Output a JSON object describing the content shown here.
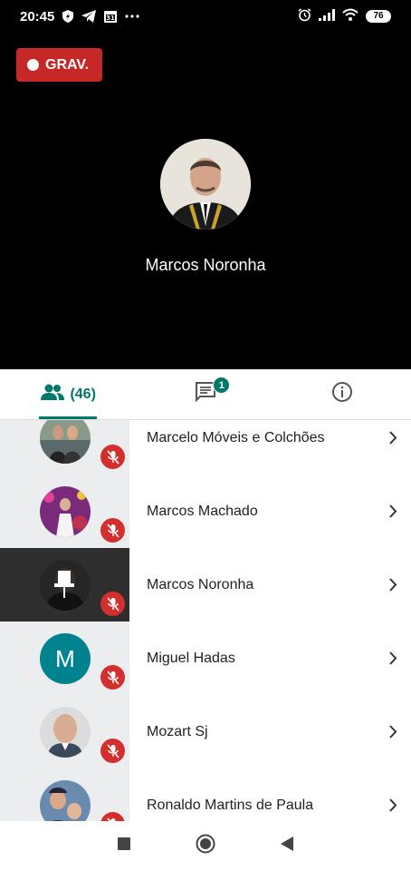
{
  "status_bar": {
    "time": "20:45",
    "battery": "76"
  },
  "video": {
    "record_label": "GRAV.",
    "speaker_name": "Marcos Noronha"
  },
  "tabs": {
    "people_count": "(46)",
    "chat_badge": "1"
  },
  "participants": [
    {
      "name": "Marcelo Móveis e Colchões",
      "avatar_type": "photo",
      "muted": true
    },
    {
      "name": "Marcos Machado",
      "avatar_type": "photo",
      "muted": true
    },
    {
      "name": "Marcos Noronha",
      "avatar_type": "pinned",
      "muted": true,
      "highlighted": true
    },
    {
      "name": "Miguel Hadas",
      "avatar_type": "letter",
      "initial": "M",
      "avatar_color": "#00838f",
      "muted": true
    },
    {
      "name": "Mozart Sj",
      "avatar_type": "photo",
      "muted": true
    },
    {
      "name": "Ronaldo Martins de Paula",
      "avatar_type": "photo",
      "muted": true
    }
  ],
  "colors": {
    "accent": "#00796b",
    "record": "#c62828",
    "muted_mic": "#d32f2f"
  }
}
